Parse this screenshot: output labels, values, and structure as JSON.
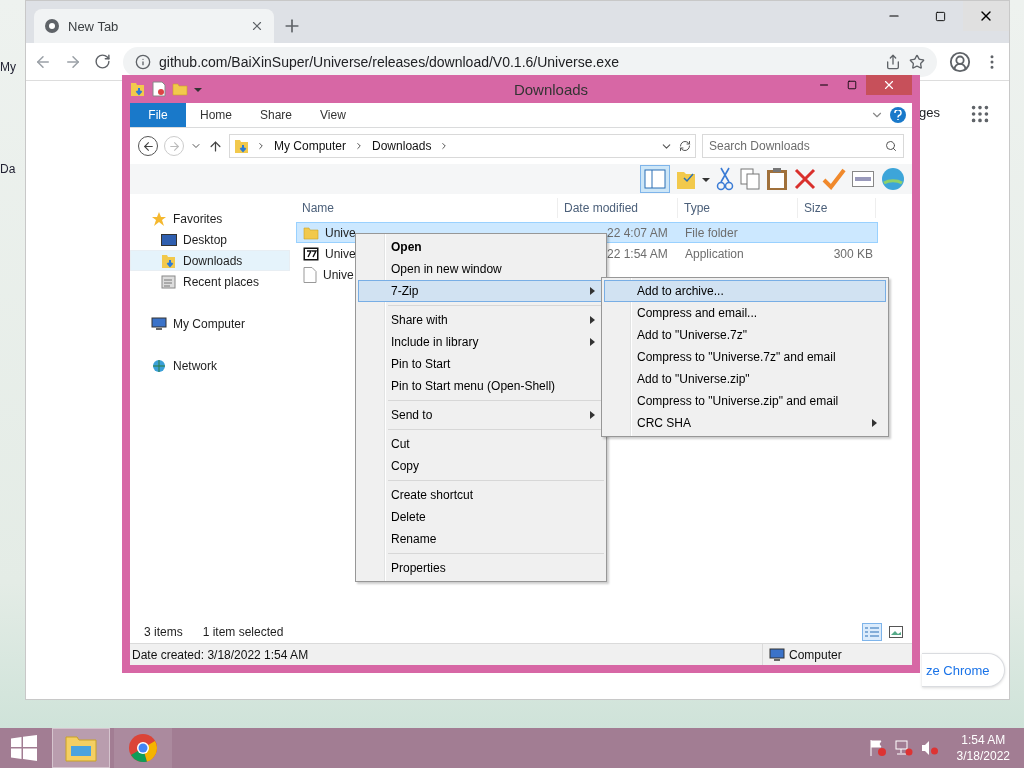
{
  "desktop": {
    "icon_labels": [
      "My",
      "Da"
    ]
  },
  "browser": {
    "tab": {
      "title": "New Tab"
    },
    "url": "github.com/BaiXinSuper/Universe/releases/download/V0.1.6/Universe.exe",
    "page_link": "ges",
    "customize_button": "ze Chrome"
  },
  "explorer": {
    "title": "Downloads",
    "ribbon_tabs": [
      {
        "label": "File",
        "kind": "menu"
      },
      {
        "label": "Home",
        "kind": "tab"
      },
      {
        "label": "Share",
        "kind": "tab"
      },
      {
        "label": "View",
        "kind": "tab"
      }
    ],
    "breadcrumb": [
      "My Computer",
      "Downloads"
    ],
    "search": {
      "placeholder": "Search Downloads"
    },
    "nav": [
      {
        "label": "Favorites",
        "kind": "star",
        "selected": false,
        "children": [
          {
            "label": "Desktop",
            "kind": "desktop",
            "selected": false
          },
          {
            "label": "Downloads",
            "kind": "downloads",
            "selected": true
          },
          {
            "label": "Recent places",
            "kind": "recent",
            "selected": false
          }
        ]
      },
      {
        "label": "My Computer",
        "kind": "computer",
        "selected": false
      },
      {
        "label": "Network",
        "kind": "network",
        "selected": false
      }
    ],
    "columns": [
      "Name",
      "Date modified",
      "Type",
      "Size"
    ],
    "rows": [
      {
        "kind": "folder",
        "name": "Unive",
        "date": "22 4:07 AM",
        "type": "File folder",
        "selected": true
      },
      {
        "kind": "archive",
        "name": "Unive",
        "date": "22 1:54 AM",
        "type": "Application",
        "size": "300 KB",
        "selected": false
      },
      {
        "kind": "file",
        "name": "Unive",
        "selected": false
      }
    ],
    "status": {
      "item_count": "3 items",
      "selection": "1 item selected"
    },
    "details_bar": {
      "date_created": "Date created: 3/18/2022 1:54 AM",
      "location": "Computer"
    }
  },
  "context_menu": {
    "items": [
      {
        "kind": "item",
        "label": "Open",
        "default": true,
        "submenu": false,
        "selected": false
      },
      {
        "kind": "item",
        "label": "Open in new window",
        "default": false,
        "submenu": false,
        "selected": false
      },
      {
        "kind": "item",
        "label": "7-Zip",
        "default": false,
        "submenu": true,
        "selected": true
      },
      {
        "kind": "separator"
      },
      {
        "kind": "item",
        "label": "Share with",
        "default": false,
        "submenu": true,
        "selected": false
      },
      {
        "kind": "item",
        "label": "Include in library",
        "default": false,
        "submenu": true,
        "selected": false
      },
      {
        "kind": "item",
        "label": "Pin to Start",
        "default": false,
        "submenu": false,
        "selected": false
      },
      {
        "kind": "item",
        "label": "Pin to Start menu (Open-Shell)",
        "default": false,
        "submenu": false,
        "selected": false
      },
      {
        "kind": "separator"
      },
      {
        "kind": "item",
        "label": "Send to",
        "default": false,
        "submenu": true,
        "selected": false
      },
      {
        "kind": "separator"
      },
      {
        "kind": "item",
        "label": "Cut",
        "default": false,
        "submenu": false,
        "selected": false
      },
      {
        "kind": "item",
        "label": "Copy",
        "default": false,
        "submenu": false,
        "selected": false
      },
      {
        "kind": "separator"
      },
      {
        "kind": "item",
        "label": "Create shortcut",
        "default": false,
        "submenu": false,
        "selected": false
      },
      {
        "kind": "item",
        "label": "Delete",
        "default": false,
        "submenu": false,
        "selected": false
      },
      {
        "kind": "item",
        "label": "Rename",
        "default": false,
        "submenu": false,
        "selected": false
      },
      {
        "kind": "separator"
      },
      {
        "kind": "item",
        "label": "Properties",
        "default": false,
        "submenu": false,
        "selected": false
      }
    ]
  },
  "submenu": {
    "items": [
      {
        "kind": "item",
        "label": "Add to archive...",
        "default": false,
        "submenu": false,
        "selected": true
      },
      {
        "kind": "item",
        "label": "Compress and email...",
        "default": false,
        "submenu": false,
        "selected": false
      },
      {
        "kind": "item",
        "label": "Add to \"Universe.7z\"",
        "default": false,
        "submenu": false,
        "selected": false
      },
      {
        "kind": "item",
        "label": "Compress to \"Universe.7z\" and email",
        "default": false,
        "submenu": false,
        "selected": false
      },
      {
        "kind": "item",
        "label": "Add to \"Universe.zip\"",
        "default": false,
        "submenu": false,
        "selected": false
      },
      {
        "kind": "item",
        "label": "Compress to \"Universe.zip\" and email",
        "default": false,
        "submenu": false,
        "selected": false
      },
      {
        "kind": "item",
        "label": "CRC SHA",
        "default": false,
        "submenu": true,
        "selected": false
      }
    ]
  },
  "taskbar": {
    "apps": [
      {
        "kind": "explorer",
        "selected": true
      },
      {
        "kind": "chrome",
        "selected": false
      }
    ],
    "time": "1:54 AM",
    "date": "3/18/2022"
  }
}
